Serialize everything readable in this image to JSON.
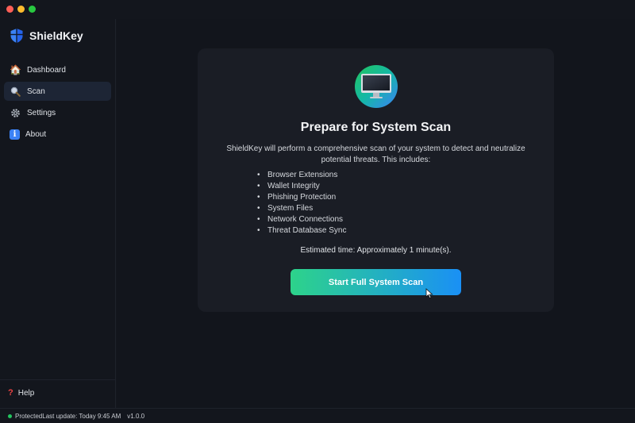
{
  "app": {
    "name": "ShieldKey"
  },
  "sidebar": {
    "items": [
      {
        "label": "Dashboard",
        "icon": "house-icon"
      },
      {
        "label": "Scan",
        "icon": "magnifier-icon",
        "active": true
      },
      {
        "label": "Settings",
        "icon": "gear-icon"
      },
      {
        "label": "About",
        "icon": "info-icon"
      }
    ],
    "help_label": "Help"
  },
  "scan_card": {
    "title": "Prepare for System Scan",
    "description": "ShieldKey will perform a comprehensive scan of your system to detect and neutralize potential threats. This includes:",
    "checks": [
      "Browser Extensions",
      "Wallet Integrity",
      "Phishing Protection",
      "System Files",
      "Network Connections",
      "Threat Database Sync"
    ],
    "estimate": "Estimated time: Approximately 1 minute(s).",
    "button_label": "Start Full System Scan"
  },
  "status_bar": {
    "protection": "Protected",
    "last_update": "Last update: Today 9:45 AM",
    "version": "v1.0.0"
  },
  "colors": {
    "accent_green": "#2dd38a",
    "accent_blue": "#1a90f5",
    "status_ok": "#22c55e"
  }
}
